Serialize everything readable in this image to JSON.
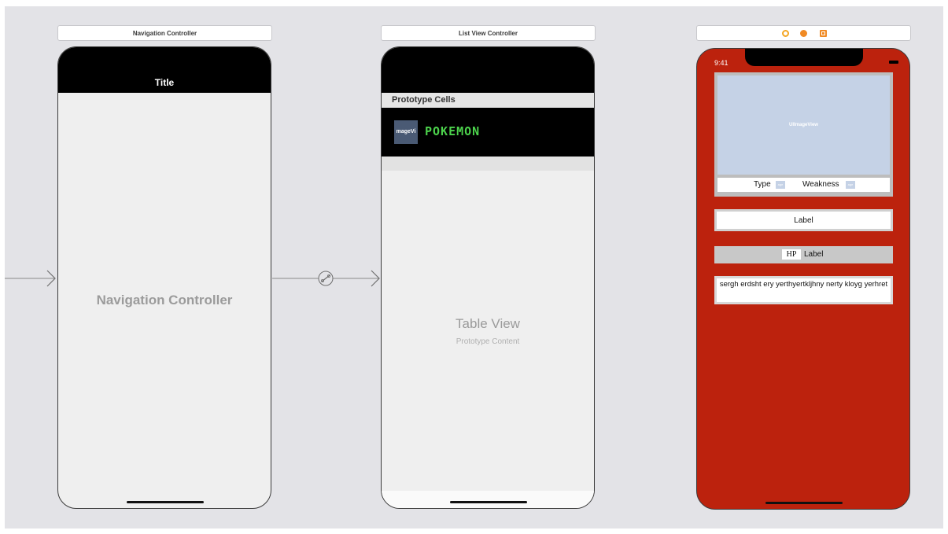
{
  "scenes": {
    "navigation": {
      "bar_title": "Navigation Controller",
      "nav_bar_title": "Title",
      "center_label": "Navigation Controller"
    },
    "list": {
      "bar_title": "List View Controller",
      "section_header": "Prototype Cells",
      "cell_image_text": "mageVi",
      "cell_title": "POKEMON",
      "table_view_label": "Table View",
      "table_view_sub": "Prototype Content"
    },
    "detail": {
      "toolbar_icons": [
        "view-controller-icon",
        "first-responder-icon",
        "exit-icon"
      ],
      "status_time": "9:41",
      "image_view_label": "UIImageView",
      "type_label": "Type",
      "weakness_label": "Weakness",
      "mini_image_text": "age",
      "name_label": "Label",
      "hp_tag": "HP",
      "hp_label": "Label",
      "description": "sergh erdsht ery yerthyertkljhny nerty kloyg  yerhret"
    }
  },
  "colors": {
    "canvas": "#e3e3e7",
    "detail_background": "#bc220d",
    "pokemon_title": "#4cd24c",
    "image_view": "#c5d2e6"
  }
}
